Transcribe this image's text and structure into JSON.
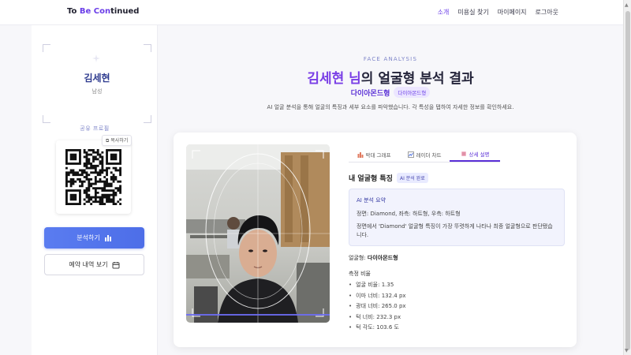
{
  "header": {
    "logo_part1": "To ",
    "logo_accent1": "Be",
    "logo_part2": " ",
    "logo_accent2": "Con",
    "logo_part3": "tinued",
    "nav": [
      "소개",
      "미용실 찾기",
      "마이페이지",
      "로그아웃"
    ],
    "active_nav_index": 0
  },
  "sidebar": {
    "user_name": "김세현",
    "gender": "남성",
    "share_label": "공유 프로필",
    "copy_label": "복사하기",
    "analyze_button": "분석하기",
    "reserve_button": "예약 내역 보기"
  },
  "main": {
    "eyebrow": "FACE ANALYSIS",
    "title_highlight": "김세현 님",
    "title_rest": "의 얼굴형 분석 결과",
    "face_type": "다이아몬드형",
    "face_type_badge": "다이아몬드형",
    "description": "AI 얼굴 분석을 통해 얼굴의 특징과 세부 요소를 파악했습니다. 각 특성을 탭하여 자세한 정보를 확인하세요."
  },
  "tabs": [
    {
      "label": "막대 그래프",
      "icon": "bar-chart-icon"
    },
    {
      "label": "레이더 차트",
      "icon": "radar-chart-icon"
    },
    {
      "label": "상세 설명",
      "icon": "detail-icon"
    }
  ],
  "active_tab_index": 2,
  "details": {
    "section_title": "내 얼굴형 특징",
    "status_badge": "AI 분석 완료",
    "summary_title": "AI 분석 요약",
    "summary_line": "정면: Diamond, 좌측: 하트형, 우측: 하트형",
    "summary_text": "정면에서 'Diamond' 얼굴형 특징이 가장 뚜렷하게 나타나 최종 얼굴형으로 판단됐습니다.",
    "face_type_label": "얼굴형:",
    "face_type_value": "다이아몬드형",
    "ratio_title": "측정 비율",
    "ratios": [
      "얼굴 비율: 1.35",
      "이마 너비: 132.4 px",
      "광대 너비: 265.0 px",
      "턱 너비: 232.3 px",
      "턱 각도: 103.6 도"
    ]
  },
  "colors": {
    "accent": "#6a3de8",
    "primary_button": "#5a7cf0",
    "name_color": "#2e3b8f"
  }
}
